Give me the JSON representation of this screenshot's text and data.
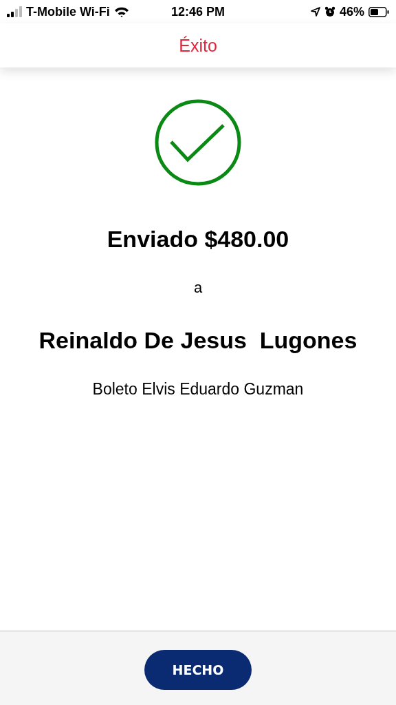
{
  "status_bar": {
    "carrier": "T-Mobile Wi-Fi",
    "time": "12:46 PM",
    "battery": "46%"
  },
  "header": {
    "title": "Éxito"
  },
  "result": {
    "amount_line": "Enviado $480.00",
    "connector": "a",
    "recipient": "Reinaldo De Jesus  Lugones",
    "memo": "Boleto Elvis Eduardo Guzman"
  },
  "footer": {
    "button": "HECHO"
  }
}
